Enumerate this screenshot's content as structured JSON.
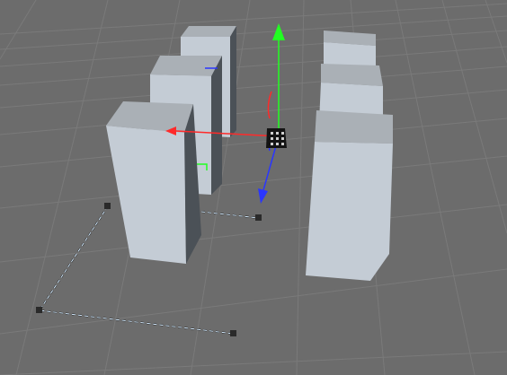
{
  "viewport": {
    "background_color": "#6c6c6c",
    "grid_color": "#7a7a7a"
  },
  "colors": {
    "cube_top": "#aab0b6",
    "cube_front": "#c4ccd5",
    "cube_side": "#4b5157",
    "axis_x": "#ff2a2a",
    "axis_y": "#22ff22",
    "axis_z": "#2a36ff",
    "spline_dark": "#1f1f1f",
    "spline_light": "#d6ecff"
  },
  "gizmo": {
    "x_axis_icon": "x-axis-arrow-icon",
    "y_axis_icon": "y-axis-arrow-icon",
    "z_axis_icon": "z-axis-arrow-icon",
    "handle_icon": "gizmo-handle-icon"
  },
  "scene": {
    "objects": [
      "box-left-front",
      "box-left-middle",
      "box-left-back",
      "box-right-front",
      "box-right-middle",
      "box-right-back"
    ]
  }
}
